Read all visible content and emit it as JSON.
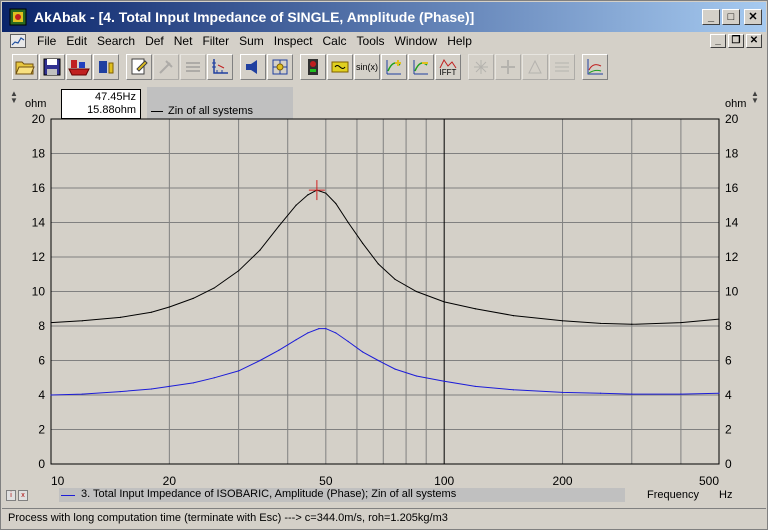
{
  "window": {
    "title": "AkAbak - [4. Total Input Impedance of SINGLE, Amplitude (Phase)]",
    "buttons": {
      "minimize": "_",
      "maximize": "□",
      "close": "✕"
    }
  },
  "menubar": {
    "items": [
      {
        "label": "File"
      },
      {
        "label": "Edit"
      },
      {
        "label": "Search"
      },
      {
        "label": "Def"
      },
      {
        "label": "Net"
      },
      {
        "label": "Filter"
      },
      {
        "label": "Sum"
      },
      {
        "label": "Inspect"
      },
      {
        "label": "Calc"
      },
      {
        "label": "Tools"
      },
      {
        "label": "Window"
      },
      {
        "label": "Help"
      }
    ],
    "mdi_buttons": {
      "minimize": "_",
      "restore": "❐",
      "close": "✕"
    }
  },
  "toolbar": {
    "tools": [
      {
        "icon": "open-folder-icon"
      },
      {
        "icon": "save-disk-icon"
      },
      {
        "icon": "ship-icon"
      },
      {
        "icon": "component-icon"
      },
      {
        "icon": "edit-document-icon"
      },
      {
        "icon": "disabled-icon"
      },
      {
        "icon": "disabled-icon"
      },
      {
        "icon": "axis-icon"
      },
      {
        "icon": "speaker-icon"
      },
      {
        "icon": "grid-cursor-icon"
      },
      {
        "icon": "meter-icon"
      },
      {
        "icon": "filter-icon"
      },
      {
        "icon": "sine-icon",
        "text": "sin(x)"
      },
      {
        "icon": "curve-plus-icon"
      },
      {
        "icon": "curve-minus-icon"
      },
      {
        "icon": "ifft-icon",
        "text": "IFFT"
      }
    ]
  },
  "cursor_readout": {
    "frequency": "47.45Hz",
    "value": "15.88ohm"
  },
  "legend": {
    "top": {
      "label": "Zin of all systems",
      "color": "#000000"
    },
    "bottom": {
      "label": "3. Total Input Impedance of ISOBARIC, Amplitude (Phase); Zin of all systems",
      "color": "#1c1cd8"
    }
  },
  "axes": {
    "y_unit_left": "ohm",
    "y_unit_right": "ohm",
    "x_label": "Frequency",
    "x_unit": "Hz"
  },
  "chart_data": {
    "type": "line",
    "x_scale": "log",
    "xlim": [
      10,
      500
    ],
    "ylim": [
      0,
      20
    ],
    "x_ticks": [
      "10",
      "20",
      "50",
      "100",
      "200",
      "500"
    ],
    "x_tick_values": [
      10,
      20,
      50,
      100,
      200,
      500
    ],
    "y_ticks": [
      "0",
      "2",
      "4",
      "6",
      "8",
      "10",
      "12",
      "14",
      "16",
      "18",
      "20"
    ],
    "y_tick_values": [
      0,
      2,
      4,
      6,
      8,
      10,
      12,
      14,
      16,
      18,
      20
    ],
    "minor_x_grid": [
      30,
      40,
      60,
      70,
      80,
      90,
      300,
      400
    ],
    "grid": true,
    "cursor": {
      "x": 47.45,
      "y": 15.88
    },
    "series": [
      {
        "name": "Zin of all systems",
        "color": "#000000",
        "x": [
          10,
          12,
          15,
          18,
          20,
          23,
          26,
          30,
          34,
          38,
          42,
          45,
          47.45,
          50,
          53,
          57,
          62,
          68,
          75,
          85,
          100,
          120,
          150,
          200,
          250,
          300,
          400,
          500
        ],
        "y": [
          8.2,
          8.3,
          8.5,
          8.8,
          9.1,
          9.6,
          10.2,
          11.2,
          12.4,
          13.8,
          15.0,
          15.6,
          15.88,
          15.7,
          15.1,
          14.0,
          12.8,
          11.6,
          10.7,
          10.0,
          9.4,
          9.0,
          8.6,
          8.3,
          8.15,
          8.1,
          8.2,
          8.4
        ]
      },
      {
        "name": "Zin of all systems",
        "color": "#1c1cd8",
        "x": [
          10,
          12,
          15,
          18,
          20,
          23,
          26,
          30,
          34,
          38,
          42,
          45,
          48,
          50,
          53,
          57,
          62,
          68,
          75,
          85,
          100,
          120,
          150,
          200,
          250,
          300,
          400,
          500
        ],
        "y": [
          4.0,
          4.05,
          4.2,
          4.35,
          4.5,
          4.7,
          5.0,
          5.4,
          6.0,
          6.6,
          7.2,
          7.6,
          7.85,
          7.85,
          7.6,
          7.1,
          6.5,
          6.0,
          5.5,
          5.1,
          4.8,
          4.5,
          4.3,
          4.15,
          4.1,
          4.05,
          4.05,
          4.1
        ]
      }
    ]
  },
  "statusbar": {
    "text": "Process with long computation time (terminate with Esc) ---> c=344.0m/s, roh=1.205kg/m3"
  }
}
